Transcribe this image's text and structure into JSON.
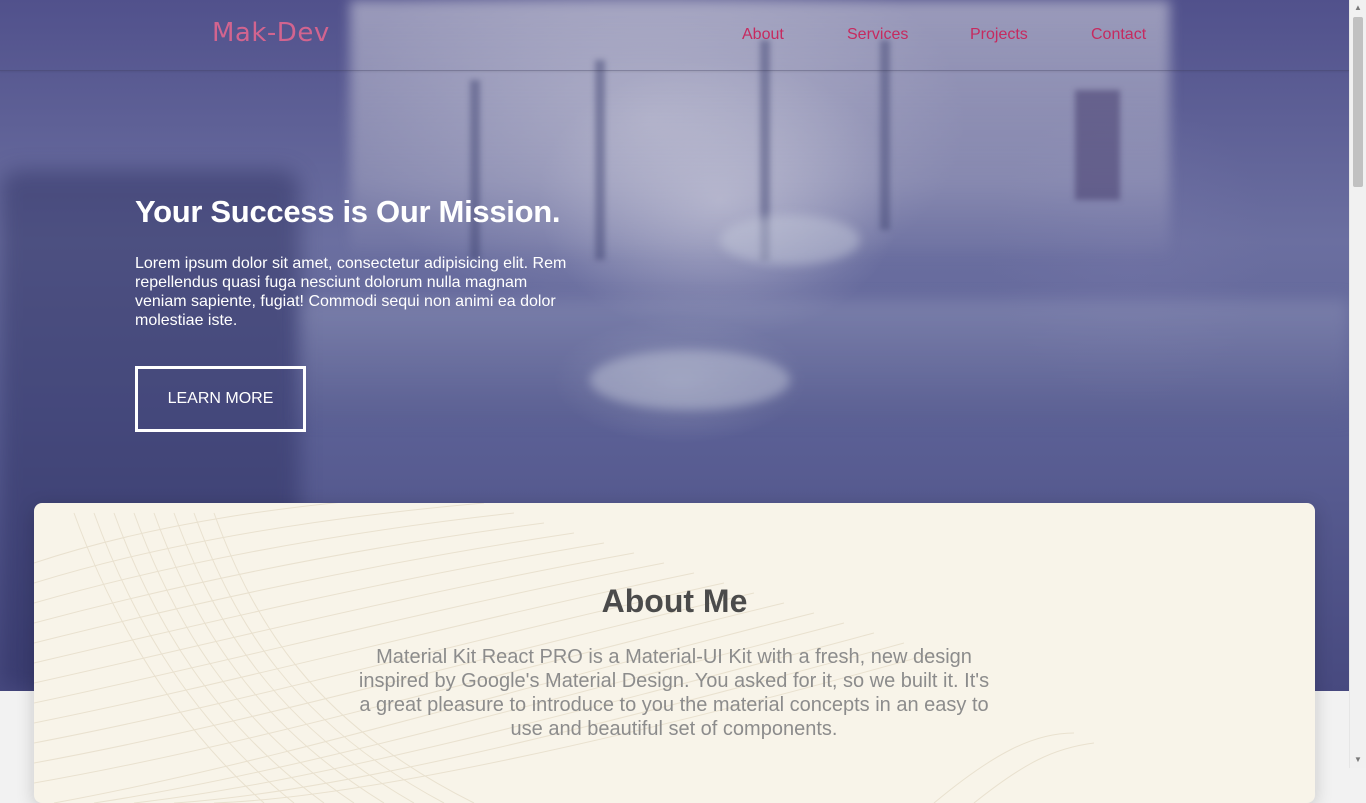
{
  "brand": "Mak-Dev",
  "nav": {
    "items": [
      {
        "label": "About"
      },
      {
        "label": "Services"
      },
      {
        "label": "Projects"
      },
      {
        "label": "Contact"
      }
    ]
  },
  "hero": {
    "title": "Your Success is Our Mission.",
    "text": "Lorem ipsum dolor sit amet, consectetur adipisicing elit. Rem repellendus quasi fuga nesciunt dolorum nulla magnam veniam sapiente, fugiat! Commodi sequi non animi ea dolor molestiae iste.",
    "button_label": "LEARN MORE"
  },
  "about": {
    "title": "About Me",
    "text": "Material Kit React PRO is a Material-UI Kit with a fresh, new design inspired by Google's Material Design. You asked for it, so we built it. It's a great pleasure to introduce to you the material concepts in an easy to use and beautiful set of components."
  },
  "colors": {
    "brand": "#d2648f",
    "nav_link": "#c62a5f",
    "hero_overlay": "#4d4f8a",
    "card_bg": "#f8f4e9"
  },
  "icons": {
    "scroll_up": "triangle-up",
    "scroll_down": "triangle-down"
  }
}
